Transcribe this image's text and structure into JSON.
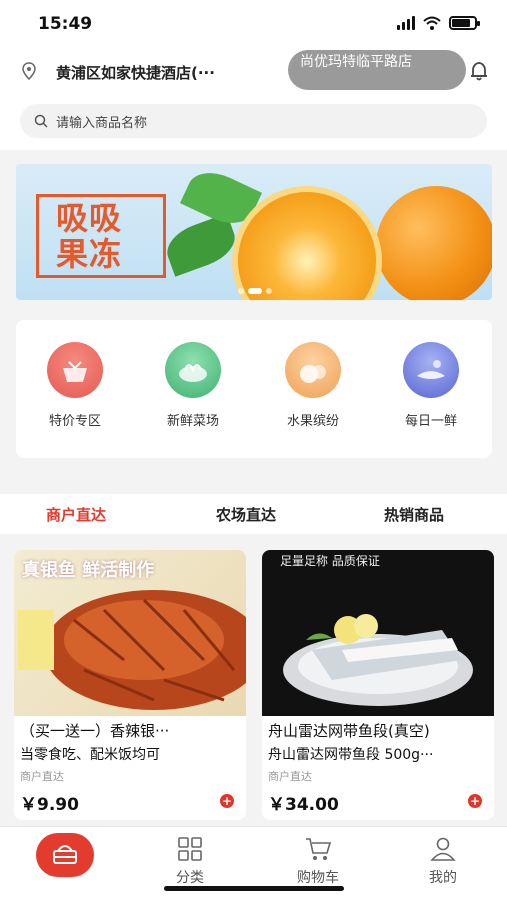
{
  "status_bar": {
    "time": "15:49",
    "battery_level": 0.8
  },
  "header": {
    "address": "黄浦区如家快捷酒店(···",
    "store": "尚优玛特临平路店",
    "search_placeholder": "请输入商品名称"
  },
  "banner": {
    "text_line1": "吸吸",
    "text_line2": "果冻",
    "slide_count": 3,
    "active_slide": 2
  },
  "categories": [
    {
      "label": "特价专区",
      "icon": "special-offer-icon",
      "color": "#e65a52"
    },
    {
      "label": "新鲜菜场",
      "icon": "fresh-vegetable-icon",
      "color": "#56c47f"
    },
    {
      "label": "水果缤纷",
      "icon": "fruit-icon",
      "color": "#f2a25a"
    },
    {
      "label": "每日一鲜",
      "icon": "daily-fresh-icon",
      "color": "#6474d8"
    }
  ],
  "tabs": [
    {
      "label": "商户直达",
      "active": true
    },
    {
      "label": "农场直达",
      "active": false
    },
    {
      "label": "热销商品",
      "active": false
    }
  ],
  "products": [
    {
      "image_text_1": "真银鱼 鲜活制作",
      "image_text_2": "",
      "title": "（买一送一）香辣银···",
      "subtitle": "当零食吃、配米饭均可",
      "tag": "商户直达",
      "price": "￥9.90"
    },
    {
      "image_text_1": "足量足称 品质保证",
      "image_text_2": "",
      "title": "舟山雷达网带鱼段(真空)",
      "subtitle": "舟山雷达网带鱼段 500g···",
      "tag": "商户直达",
      "price": "￥34.00"
    }
  ],
  "bottom_nav": [
    {
      "label": "",
      "icon": "home-basket-icon"
    },
    {
      "label": "分类",
      "icon": "category-grid-icon"
    },
    {
      "label": "购物车",
      "icon": "cart-icon"
    },
    {
      "label": "我的",
      "icon": "profile-icon"
    }
  ],
  "colors": {
    "accent": "#e43b2f",
    "banner_text": "#e55a2b"
  }
}
